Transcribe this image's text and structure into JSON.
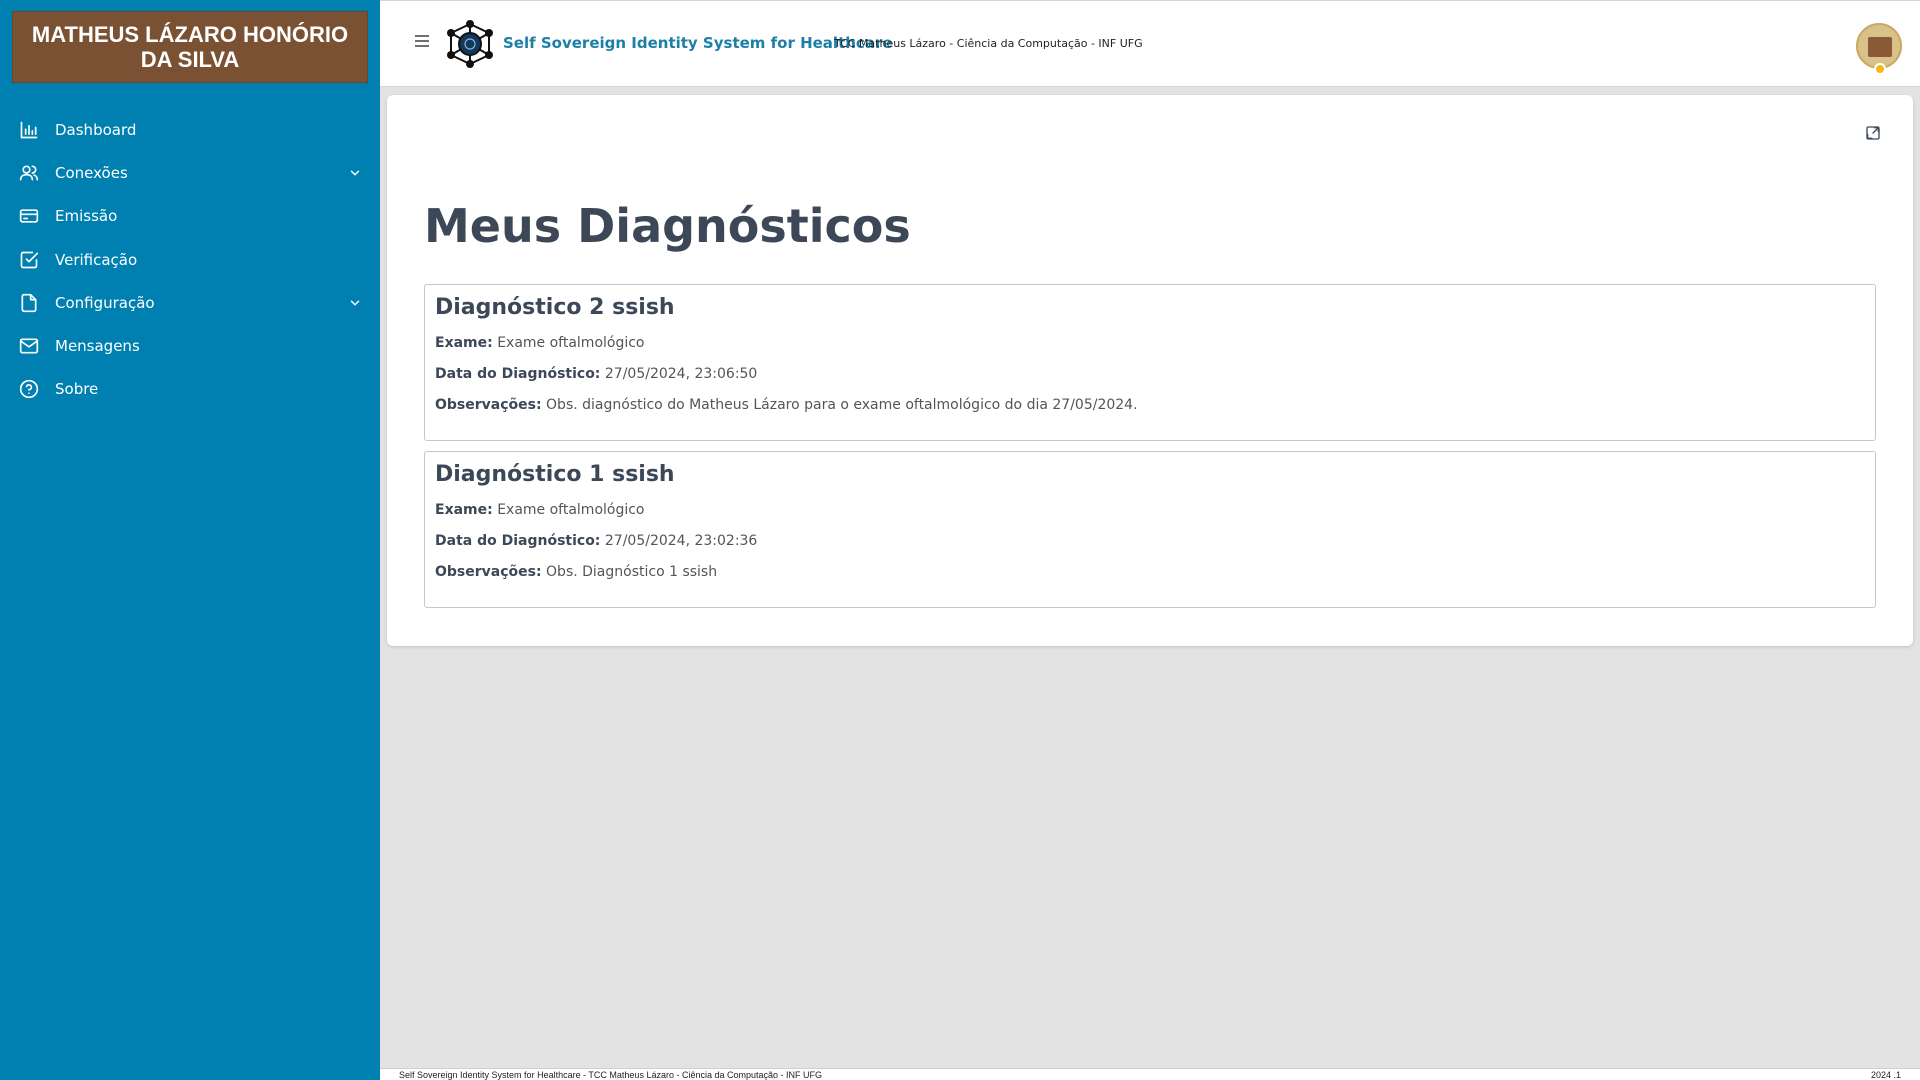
{
  "sidebar": {
    "user_name": "MATHEUS LÁZARO HONÓRIO DA SILVA",
    "items": [
      {
        "label": "Dashboard",
        "icon": "bar-chart-icon"
      },
      {
        "label": "Conexões",
        "icon": "users-icon",
        "expandable": true
      },
      {
        "label": "Emissão",
        "icon": "credit-card-icon"
      },
      {
        "label": "Verificação",
        "icon": "check-square-icon"
      },
      {
        "label": "Configuração",
        "icon": "file-icon",
        "expandable": true
      },
      {
        "label": "Mensagens",
        "icon": "mail-icon"
      },
      {
        "label": "Sobre",
        "icon": "help-circle-icon"
      }
    ]
  },
  "header": {
    "app_title": "Self Sovereign Identity System for Healthcare",
    "subtitle": "TCC Matheus Lázaro - Ciência da Computação - INF UFG"
  },
  "main": {
    "title": "Meus Diagnósticos",
    "diagnostics": [
      {
        "title": "Diagnóstico 2 ssish",
        "exam_label": "Exame:",
        "exam": "Exame oftalmológico",
        "date_label": "Data do Diagnóstico:",
        "date": "27/05/2024, 23:06:50",
        "obs_label": "Observações:",
        "obs": "Obs. diagnóstico do Matheus Lázaro para o exame oftalmológico do dia 27/05/2024."
      },
      {
        "title": "Diagnóstico 1 ssish",
        "exam_label": "Exame:",
        "exam": "Exame oftalmológico",
        "date_label": "Data do Diagnóstico:",
        "date": "27/05/2024, 23:02:36",
        "obs_label": "Observações:",
        "obs": "Obs. Diagnóstico 1 ssish"
      }
    ]
  },
  "footer": {
    "left": "Self Sovereign Identity System for Healthcare - TCC Matheus Lázaro - Ciência da Computação - INF UFG",
    "right": "2024 .1"
  },
  "colors": {
    "sidebar_bg": "#0080b0",
    "profile_bg": "#7a5233",
    "accent": "#1d7fa6",
    "page_bg": "#e3e3e3"
  }
}
